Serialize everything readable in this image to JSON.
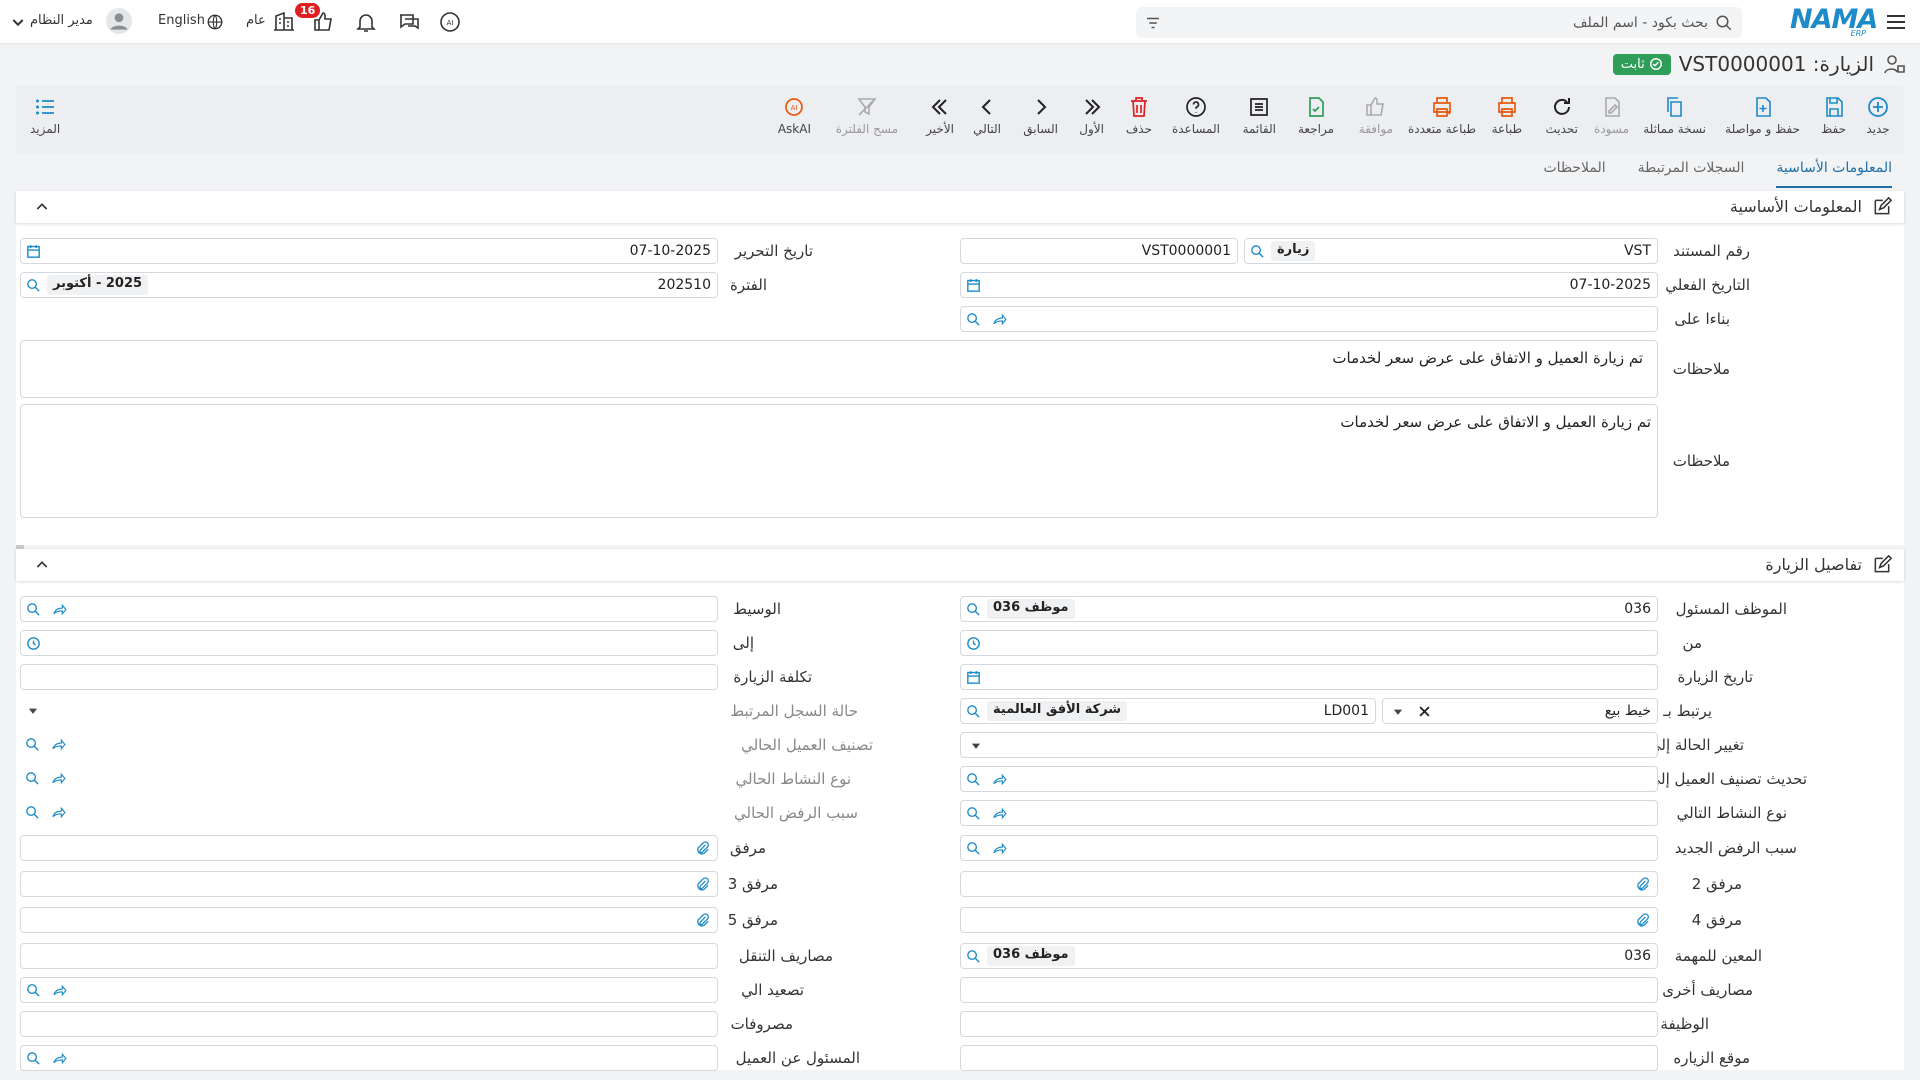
{
  "topbar": {
    "search_placeholder": "بحث بكود - اسم الملف",
    "notifications_count": "16",
    "general_label": "عام",
    "language_label": "English",
    "user_name": "مدير النظام"
  },
  "page": {
    "title": "الزيارة: VST0000001",
    "status": "ثابت"
  },
  "toolbar": {
    "new": "جديد",
    "save": "حفظ",
    "save_continue": "حفظ و مواصلة",
    "copy": "نسخة مماثلة",
    "draft": "مسودة",
    "refresh": "تحديث",
    "print": "طباعة",
    "multi_print": "طباعة متعددة",
    "approve": "موافقة",
    "review": "مراجعة",
    "list": "القائمة",
    "help": "المساعدة",
    "delete": "حذف",
    "first": "الأول",
    "previous": "السابق",
    "next": "التالي",
    "last": "الأخير",
    "clear_filter": "مسح الفلترة",
    "askai": "AskAI",
    "more": "المزيد"
  },
  "tabs": [
    "المعلومات الأساسية",
    "السجلات المرتبطة",
    "الملاحظات"
  ],
  "basic": {
    "section_title": "المعلومات الأساسية",
    "doc_no_label": "رقم المستند",
    "doc_prefix": "VST",
    "doc_type": "زيارة",
    "doc_number": "VST0000001",
    "edit_date_label": "تاريخ التحرير",
    "edit_date": "07-10-2025",
    "actual_date_label": "التاريخ الفعلي",
    "actual_date": "07-10-2025",
    "period_label": "الفترة",
    "period_code": "202510",
    "period_name": "2025 - أكتوبر",
    "based_on_label": "بناءا على",
    "notes_label": "ملاحظات",
    "notes_value": "تم زيارة العميل و الاتفاق على عرض سعر لخدمات",
    "notes2_label": "ملاحظات",
    "notes2_value": "تم زيارة العميل و الاتفاق على عرض سعر لخدمات"
  },
  "details": {
    "section_title": "تفاصيل الزيارة",
    "responsible_label": "الموظف المسئول",
    "responsible_code": "036",
    "responsible_name": "موظف 036",
    "broker_label": "الوسيط",
    "from_label": "من",
    "to_label": "إلى",
    "visit_date_label": "تاريخ الزيارة",
    "visit_cost_label": "تكلفة الزيارة",
    "linked_label": "يرتبط بـ",
    "linked_type": "خيط بيع",
    "linked_code": "LD001",
    "linked_name": "شركة الأفق العالمية",
    "linked_status_label": "حالة السجل المرتبط",
    "change_status_label": "تغيير الحالة إلى",
    "current_class_label": "تصنيف العميل الحالي",
    "update_class_label": "تحديث تصنيف العميل إلى",
    "current_activity_label": "نوع النشاط الحالي",
    "next_activity_label": "نوع النشاط التالي",
    "current_reject_label": "سبب الرفض الحالي",
    "new_reject_label": "سبب الرفض الجديد",
    "attach_label": "مرفق",
    "attach2_label": "مرفق 2",
    "attach3_label": "مرفق 3",
    "attach4_label": "مرفق 4",
    "attach5_label": "مرفق 5",
    "assigned_label": "المعين للمهمة",
    "assigned_code": "036",
    "assigned_name": "موظف 036",
    "travel_label": "مصاريف التنقل",
    "other_exp_label": "مصاريف أخرى",
    "escalate_label": "تصعيد الي",
    "job_label": "الوظيفة",
    "expenses_label": "مصروفات",
    "visit_location_label": "موقع الزياره",
    "client_resp_label": "المسئول عن العميل"
  },
  "colors": {
    "accent": "#1e8bc9",
    "success": "#2e9e58",
    "danger": "#e02020",
    "toolbar_orange": "#e8590c"
  }
}
